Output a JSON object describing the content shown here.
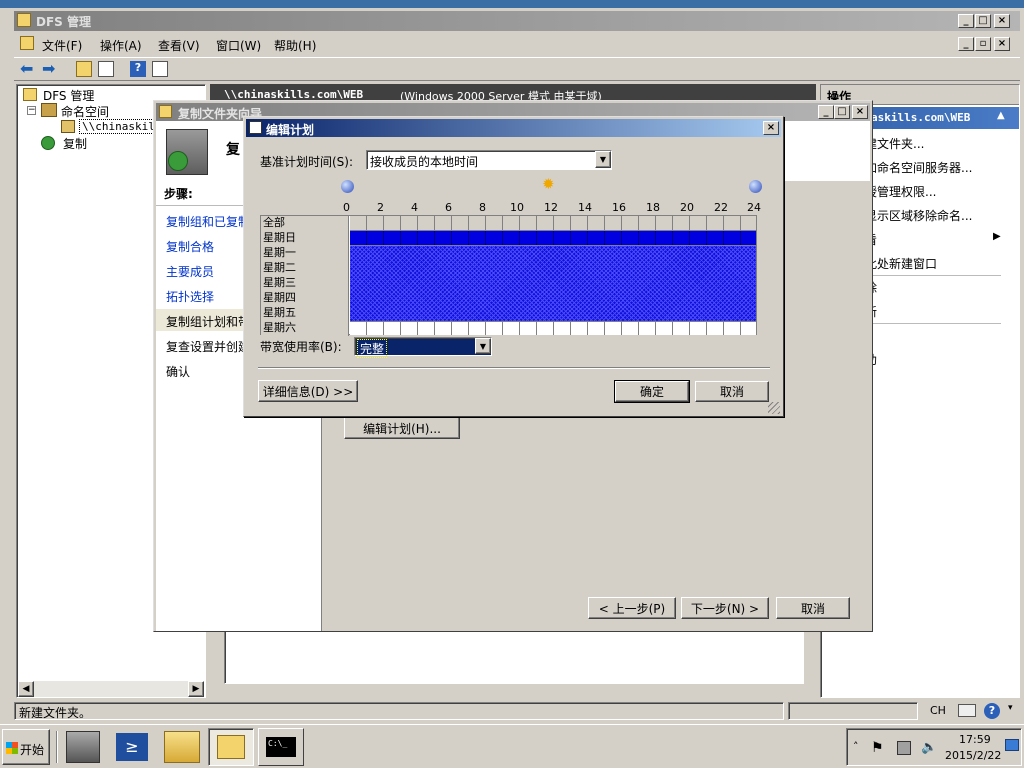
{
  "main_window": {
    "title": "DFS 管理",
    "menus": [
      "文件(F)",
      "操作(A)",
      "查看(V)",
      "窗口(W)",
      "帮助(H)"
    ],
    "status_text": "新建文件夹。",
    "status_ch": "CH"
  },
  "tree": {
    "root": "DFS 管理",
    "namespaces": "命名空间",
    "namespace_item": "\\\\chinaskill",
    "replication": "复制"
  },
  "center_header": {
    "path": "\\\\chinaskills.com\\WEB",
    "mode": "(Windows 2000 Server 模式 由某于域)"
  },
  "actions_pane": {
    "header": "操作",
    "section": "askills.com\\WEB",
    "items": [
      "建文件夹...",
      "加命名空间服务器...",
      "授管理权限...",
      "显示区域移除命名...",
      "看",
      "此处新建窗口",
      "除",
      "新",
      "助"
    ]
  },
  "wizard": {
    "title": "复制文件夹向导",
    "heading": "复",
    "steps_title": "步骤:",
    "steps": [
      "复制组和已复制",
      "复制合格",
      "主要成员",
      "拓扑选择",
      "复制组计划和带",
      "复查设置并创建",
      "确认"
    ],
    "edit_schedule_button": "编辑计划(H)...",
    "back_button": "< 上一步(P)",
    "next_button": "下一步(N) >",
    "cancel_button": "取消"
  },
  "schedule_dialog": {
    "title": "编辑计划",
    "base_time_label": "基准计划时间(S):",
    "base_time_value": "接收成员的本地时间",
    "hour_labels": [
      "0",
      "2",
      "4",
      "6",
      "8",
      "10",
      "12",
      "14",
      "16",
      "18",
      "20",
      "22",
      "24"
    ],
    "days": [
      "全部",
      "星期日",
      "星期一",
      "星期二",
      "星期三",
      "星期四",
      "星期五",
      "星期六"
    ],
    "bandwidth_label": "带宽使用率(B):",
    "bandwidth_value": "完整",
    "details_button": "详细信息(D) >>",
    "ok_button": "确定",
    "cancel_button": "取消"
  },
  "taskbar": {
    "start_label": "开始",
    "time": "17:59",
    "date": "2015/2/22"
  }
}
